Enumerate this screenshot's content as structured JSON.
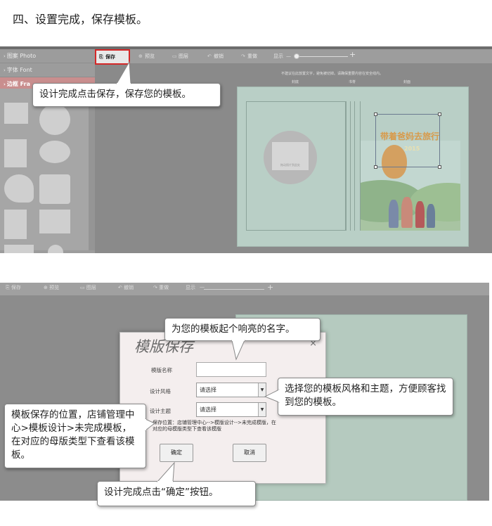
{
  "heading": "四、设置完成，保存模板。",
  "panel1": {
    "sidebar": {
      "items": [
        {
          "label": "图案 Photo"
        },
        {
          "label": "字体 Font"
        },
        {
          "label": "边框 Fra"
        }
      ]
    },
    "toolbar": {
      "save": "保存",
      "preview": "预览",
      "layers": "图层",
      "undo": "撤销",
      "redo": "重做",
      "zoom_label": "显示",
      "zoom_minus": "—",
      "zoom_plus": "+"
    },
    "hint": "不建议在此放置文字，避免被切掉。请确保重要内容在安全线内。",
    "cover_labels": [
      "封底",
      "书脊",
      "封面"
    ],
    "photo_placeholder": "拖动照片到此处",
    "art_title": "带着爸妈去旅行",
    "art_year": "2015",
    "callout": "设计完成点击保存，保存您的模板。"
  },
  "panel2": {
    "toolbar": {
      "save": "保存",
      "preview": "预览",
      "layers": "图层",
      "undo": "撤销",
      "redo": "重做",
      "zoom_label": "显示",
      "zoom_minus": "—",
      "zoom_plus": "+"
    },
    "dialog": {
      "title": "模版保存",
      "close": "×",
      "name_label": "模版名称",
      "name_value": "",
      "style_label": "设计风格",
      "style_value": "请选择",
      "theme_label": "设计主题",
      "theme_value": "请选择",
      "path_text": "保存位置：店铺管理中心-->模版设计-->未完成模版，在对应的母模版类型下查看该模版",
      "confirm": "确定",
      "cancel": "取消"
    },
    "callouts": {
      "name": "为您的模板起个响亮的名字。",
      "style": "选择您的模板风格和主题，方便顾客找到您的模板。",
      "location": "模板保存的位置，店铺管理中心>模板设计>未完成模板，在对应的母版类型下查看该模板。",
      "confirm": "设计完成点击“确定”按钮。"
    }
  }
}
